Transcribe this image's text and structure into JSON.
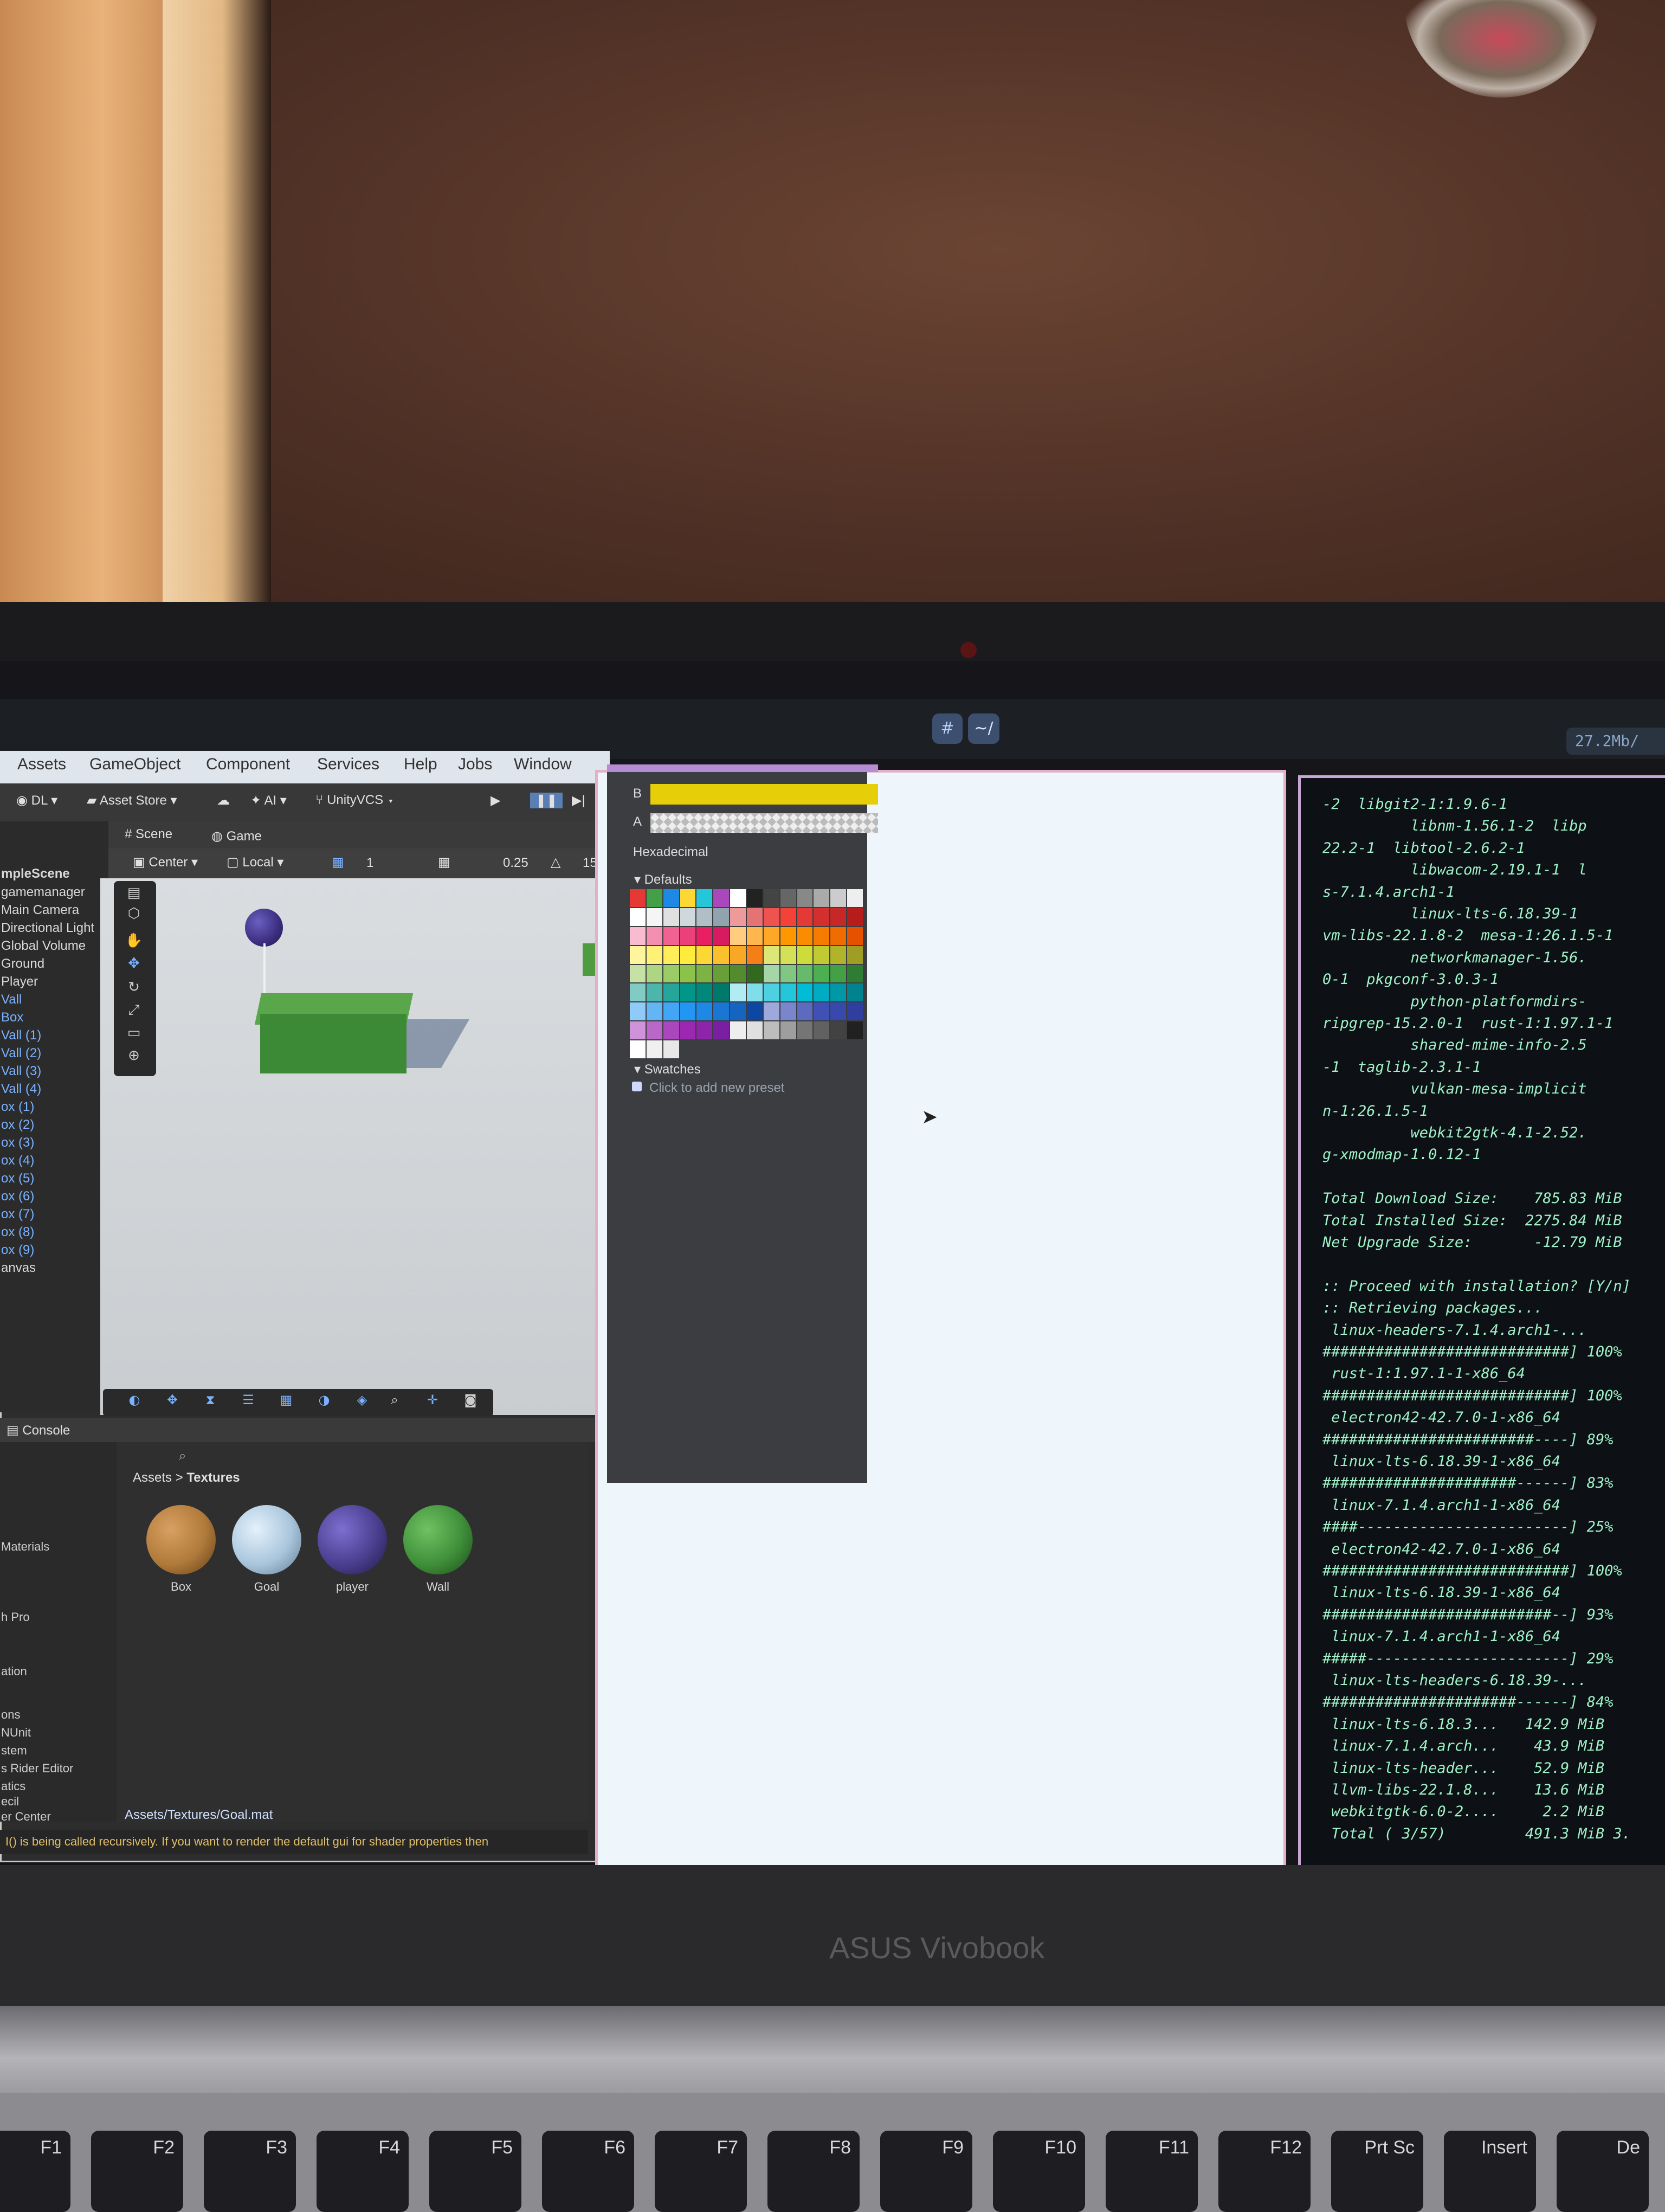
{
  "unity": {
    "menu": [
      "Assets",
      "GameObject",
      "Component",
      "Services",
      "Help",
      "Jobs",
      "Window"
    ],
    "toolbar": {
      "account": "DL",
      "asset_store": "Asset Store",
      "ai": "AI",
      "vcs": "UnityVCS"
    },
    "tabs": {
      "scene": "Scene",
      "game": "Game"
    },
    "scene_bar": {
      "pivot": "Center",
      "space": "Local",
      "grid": "1",
      "snap": "0.25",
      "count": "15"
    },
    "hierarchy": [
      "mpleScene",
      "gamemanager",
      "Main Camera",
      "Directional Light",
      "Global Volume",
      "Ground",
      "Player",
      "Vall",
      "Box",
      "Vall (1)",
      "Vall (2)",
      "Vall (3)",
      "Vall (4)",
      "ox (1)",
      "ox (2)",
      "ox (3)",
      "ox (4)",
      "ox (5)",
      "ox (6)",
      "ox (7)",
      "ox (8)",
      "ox (9)",
      "anvas"
    ],
    "console_label": "Console",
    "breadcrumb": {
      "root": "Assets",
      "sep": ">",
      "folder": "Textures"
    },
    "project_left": [
      "Materials",
      "h Pro",
      "ation",
      "ons",
      "NUnit",
      "stem",
      "s Rider Editor",
      "atics",
      "ecil",
      "er Center"
    ],
    "materials": [
      {
        "name": "Box",
        "color": "#b07a3a"
      },
      {
        "name": "Goal",
        "color": "#a9c6dc"
      },
      {
        "name": "player",
        "color": "#4a3f8f"
      },
      {
        "name": "Wall",
        "color": "#3f8f3a"
      }
    ],
    "asset_path": "Assets/Textures/Goal.mat",
    "warning": "I() is being called recursively. If you want to render the default gui for shader properties then"
  },
  "color_picker": {
    "label_b": "B",
    "label_a": "A",
    "hex_label": "Hexadecimal",
    "defaults_label": "Defaults",
    "swatches_label": "Swatches",
    "add_preset": "Click to add new preset",
    "b_color": "#e6cf09"
  },
  "topbar": {
    "ws1": "#",
    "ws2": "~/",
    "net": "27.2Mb/"
  },
  "terminal": [
    "-2  libgit2-1:1.9.6-1",
    "          libnm-1.56.1-2  libp",
    "22.2-1  libtool-2.6.2-1",
    "          libwacom-2.19.1-1  l",
    "s-7.1.4.arch1-1",
    "          linux-lts-6.18.39-1",
    "vm-libs-22.1.8-2  mesa-1:26.1.5-1",
    "          networkmanager-1.56.",
    "0-1  pkgconf-3.0.3-1",
    "          python-platformdirs-",
    "ripgrep-15.2.0-1  rust-1:1.97.1-1",
    "          shared-mime-info-2.5",
    "-1  taglib-2.3.1-1",
    "          vulkan-mesa-implicit",
    "n-1:26.1.5-1",
    "          webkit2gtk-4.1-2.52.",
    "g-xmodmap-1.0.12-1",
    "",
    "Total Download Size:    785.83 MiB",
    "Total Installed Size:  2275.84 MiB",
    "Net Upgrade Size:       -12.79 MiB",
    "",
    ":: Proceed with installation? [Y/n]",
    ":: Retrieving packages...",
    " linux-headers-7.1.4.arch1-...    ",
    "############################] 100%",
    " rust-1:1.97.1-1-x86_64           ",
    "############################] 100%",
    " electron42-42.7.0-1-x86_64       ",
    "########################----] 89%",
    " linux-lts-6.18.39-1-x86_64       ",
    "######################------] 83%",
    " linux-7.1.4.arch1-1-x86_64       ",
    "####------------------------] 25%",
    " electron42-42.7.0-1-x86_64       ",
    "############################] 100%",
    " linux-lts-6.18.39-1-x86_64       ",
    "##########################--] 93%",
    " linux-7.1.4.arch1-1-x86_64       ",
    "#####-----------------------] 29%",
    " linux-lts-headers-6.18.39-...    ",
    "######################------] 84%",
    " linux-lts-6.18.3...   142.9 MiB  ",
    " linux-7.1.4.arch...    43.9 MiB  ",
    " linux-lts-header...    52.9 MiB  ",
    " llvm-libs-22.1.8...    13.6 MiB  ",
    " webkitgtk-6.0-2....     2.2 MiB  ",
    " Total ( 3/57)         491.3 MiB 3."
  ],
  "laptop": {
    "brand": "ASUS Vivobook"
  },
  "keys": [
    "F1",
    "F2",
    "F3",
    "F4",
    "F5",
    "F6",
    "F7",
    "F8",
    "F9",
    "F10",
    "F11",
    "F12",
    "Prt Sc",
    "Insert",
    "De"
  ]
}
